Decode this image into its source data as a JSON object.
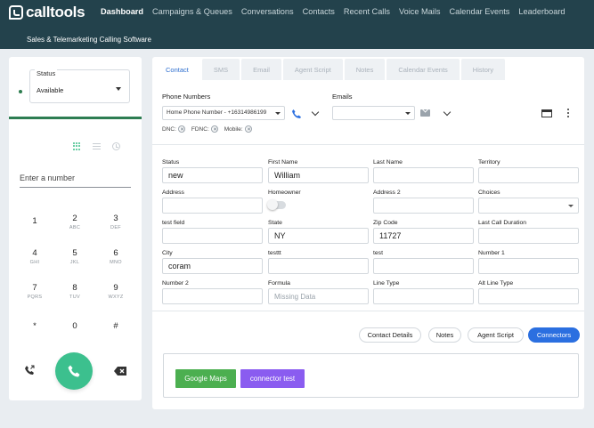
{
  "app": {
    "logo_text": "calltools",
    "tagline": "Sales & Telemarketing Calling Software"
  },
  "nav": [
    {
      "label": "Dashboard",
      "active": true
    },
    {
      "label": "Campaigns & Queues",
      "active": false
    },
    {
      "label": "Conversations",
      "active": false
    },
    {
      "label": "Contacts",
      "active": false
    },
    {
      "label": "Recent Calls",
      "active": false
    },
    {
      "label": "Voice Mails",
      "active": false
    },
    {
      "label": "Calendar Events",
      "active": false
    },
    {
      "label": "Leaderboard",
      "active": false
    }
  ],
  "dialer": {
    "status_label": "Status",
    "status_value": "Available",
    "number_placeholder": "Enter a number",
    "keys": [
      {
        "digit": "1",
        "letters": ""
      },
      {
        "digit": "2",
        "letters": "ABC"
      },
      {
        "digit": "3",
        "letters": "DEF"
      },
      {
        "digit": "4",
        "letters": "GHI"
      },
      {
        "digit": "5",
        "letters": "JKL"
      },
      {
        "digit": "6",
        "letters": "MNO"
      },
      {
        "digit": "7",
        "letters": "PQRS"
      },
      {
        "digit": "8",
        "letters": "TUV"
      },
      {
        "digit": "9",
        "letters": "WXYZ"
      },
      {
        "digit": "*",
        "letters": ""
      },
      {
        "digit": "0",
        "letters": ""
      },
      {
        "digit": "#",
        "letters": ""
      }
    ]
  },
  "tabs": [
    {
      "label": "Contact",
      "active": true
    },
    {
      "label": "SMS",
      "active": false
    },
    {
      "label": "Email",
      "active": false
    },
    {
      "label": "Agent Script",
      "active": false
    },
    {
      "label": "Notes",
      "active": false
    },
    {
      "label": "Calendar Events",
      "active": false
    },
    {
      "label": "History",
      "active": false
    }
  ],
  "contact": {
    "phone_numbers_label": "Phone Numbers",
    "phone_select_value": "Home Phone Number - +16314986199",
    "emails_label": "Emails",
    "dnc_label": "DNC:",
    "fdnc_label": "FDNC:",
    "mobile_label": "Mobile:",
    "fields": [
      {
        "label": "Status",
        "value": "new"
      },
      {
        "label": "First Name",
        "value": "William"
      },
      {
        "label": "Last Name",
        "value": ""
      },
      {
        "label": "Territory",
        "value": ""
      },
      {
        "label": "Address",
        "value": ""
      },
      {
        "label": "Homeowner",
        "value": ""
      },
      {
        "label": "Address 2",
        "value": ""
      },
      {
        "label": "Choices",
        "value": ""
      },
      {
        "label": "test field",
        "value": ""
      },
      {
        "label": "State",
        "value": "NY"
      },
      {
        "label": "Zip Code",
        "value": "11727"
      },
      {
        "label": "Last Call Duration",
        "value": ""
      },
      {
        "label": "City",
        "value": "coram"
      },
      {
        "label": "testtt",
        "value": ""
      },
      {
        "label": "test",
        "value": ""
      },
      {
        "label": "Number 1",
        "value": ""
      },
      {
        "label": "Number 2",
        "value": ""
      },
      {
        "label": "Formula",
        "value": "",
        "placeholder": "Missing Data"
      },
      {
        "label": "Line Type",
        "value": ""
      },
      {
        "label": "Alt Line Type",
        "value": ""
      }
    ]
  },
  "actions": {
    "contact_details": "Contact Details",
    "notes": "Notes",
    "agent_script": "Agent Script",
    "connectors": "Connectors"
  },
  "connectors": {
    "google_maps": "Google Maps",
    "connector_test": "connector test"
  },
  "colors": {
    "header": "#23424c",
    "accent_green": "#3cc08e",
    "primary_blue": "#2b6fe0",
    "google_maps_green": "#4caf50",
    "connector_purple": "#8a5cf0"
  }
}
